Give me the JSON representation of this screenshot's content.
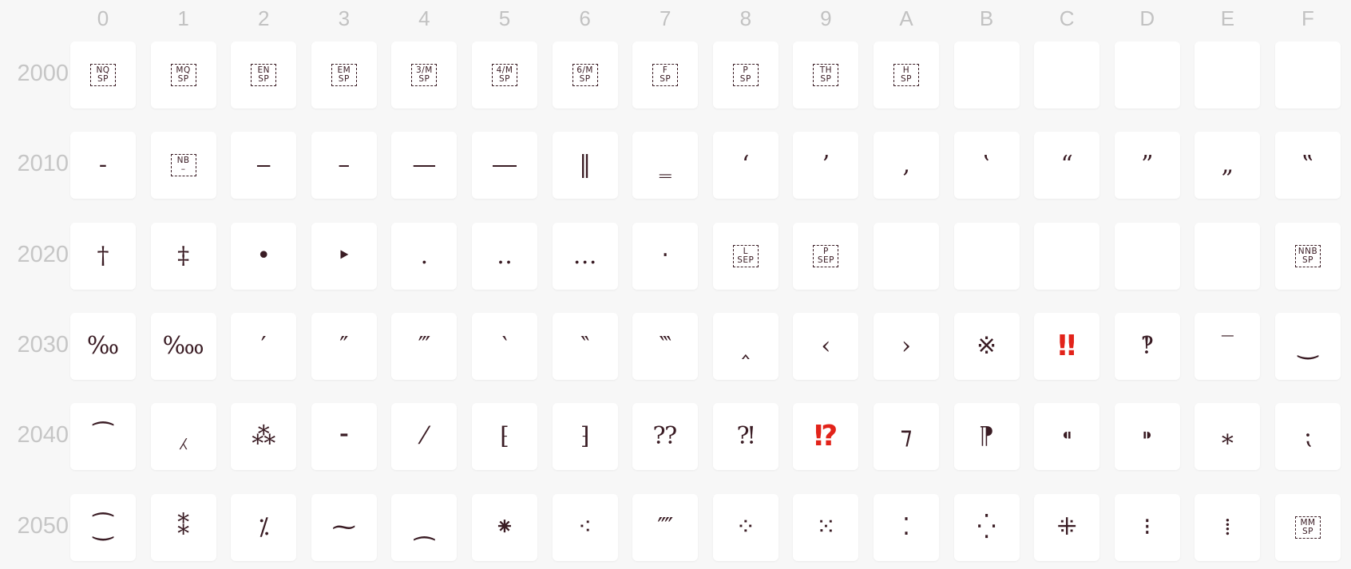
{
  "columns": [
    "0",
    "1",
    "2",
    "3",
    "4",
    "5",
    "6",
    "7",
    "8",
    "9",
    "A",
    "B",
    "C",
    "D",
    "E",
    "F"
  ],
  "rows": [
    {
      "label": "2000",
      "cells": [
        {
          "abbr": [
            "NQ",
            "SP"
          ]
        },
        {
          "abbr": [
            "MQ",
            "SP"
          ]
        },
        {
          "abbr": [
            "EN",
            "SP"
          ]
        },
        {
          "abbr": [
            "EM",
            "SP"
          ]
        },
        {
          "abbr": [
            "3/M",
            "SP"
          ]
        },
        {
          "abbr": [
            "4/M",
            "SP"
          ]
        },
        {
          "abbr": [
            "6/M",
            "SP"
          ]
        },
        {
          "abbr": [
            "F",
            "SP"
          ]
        },
        {
          "abbr": [
            "P",
            "SP"
          ]
        },
        {
          "abbr": [
            "TH",
            "SP"
          ]
        },
        {
          "abbr": [
            "H",
            "SP"
          ]
        },
        {},
        {},
        {},
        {},
        {}
      ]
    },
    {
      "label": "2010",
      "cells": [
        {
          "glyph": "‐"
        },
        {
          "abbr": [
            "NB",
            "–"
          ]
        },
        {
          "glyph": "‒"
        },
        {
          "glyph": "–"
        },
        {
          "glyph": "—"
        },
        {
          "glyph": "―"
        },
        {
          "glyph": "‖"
        },
        {
          "glyph": "‗"
        },
        {
          "glyph": "‘"
        },
        {
          "glyph": "’"
        },
        {
          "glyph": "‚"
        },
        {
          "glyph": "‛"
        },
        {
          "glyph": "“"
        },
        {
          "glyph": "”"
        },
        {
          "glyph": "„"
        },
        {
          "glyph": "‟"
        }
      ]
    },
    {
      "label": "2020",
      "cells": [
        {
          "glyph": "†"
        },
        {
          "glyph": "‡"
        },
        {
          "glyph": "•"
        },
        {
          "glyph": "‣"
        },
        {
          "glyph": "․"
        },
        {
          "glyph": "‥"
        },
        {
          "glyph": "…"
        },
        {
          "glyph": "‧"
        },
        {
          "abbr": [
            "L",
            "SEP"
          ]
        },
        {
          "abbr": [
            "P",
            "SEP"
          ]
        },
        {},
        {},
        {},
        {},
        {},
        {
          "abbr": [
            "NNB",
            "SP"
          ]
        }
      ]
    },
    {
      "label": "2030",
      "cells": [
        {
          "glyph": "‰"
        },
        {
          "glyph": "‱"
        },
        {
          "glyph": "′"
        },
        {
          "glyph": "″"
        },
        {
          "glyph": "‴"
        },
        {
          "glyph": "‵"
        },
        {
          "glyph": "‶"
        },
        {
          "glyph": "‷"
        },
        {
          "glyph": "‸"
        },
        {
          "glyph": "‹"
        },
        {
          "glyph": "›"
        },
        {
          "glyph": "※"
        },
        {
          "glyph": "‼",
          "emoji": true
        },
        {
          "glyph": "‽"
        },
        {
          "glyph": "‾"
        },
        {
          "glyph": "‿"
        }
      ]
    },
    {
      "label": "2040",
      "cells": [
        {
          "glyph": "⁀"
        },
        {
          "glyph": "⁁"
        },
        {
          "glyph": "⁂"
        },
        {
          "glyph": "⁃"
        },
        {
          "glyph": "⁄"
        },
        {
          "glyph": "⁅"
        },
        {
          "glyph": "⁆"
        },
        {
          "glyph": "⁇"
        },
        {
          "glyph": "⁈"
        },
        {
          "glyph": "⁉",
          "emoji": true
        },
        {
          "glyph": "⁊"
        },
        {
          "glyph": "⁋"
        },
        {
          "glyph": "⁌"
        },
        {
          "glyph": "⁍"
        },
        {
          "glyph": "⁎"
        },
        {
          "glyph": "⁏"
        }
      ]
    },
    {
      "label": "2050",
      "cells": [
        {
          "glyph": "⁐"
        },
        {
          "glyph": "⁑"
        },
        {
          "glyph": "⁒"
        },
        {
          "glyph": "⁓"
        },
        {
          "glyph": "⁔"
        },
        {
          "glyph": "⁕"
        },
        {
          "glyph": "⁖"
        },
        {
          "glyph": "⁗"
        },
        {
          "glyph": "⁘"
        },
        {
          "glyph": "⁙"
        },
        {
          "glyph": "⁚"
        },
        {
          "glyph": "⁛"
        },
        {
          "glyph": "⁜"
        },
        {
          "glyph": "⁝"
        },
        {
          "glyph": "⁞"
        },
        {
          "abbr": [
            "MM",
            "SP"
          ]
        }
      ]
    }
  ]
}
